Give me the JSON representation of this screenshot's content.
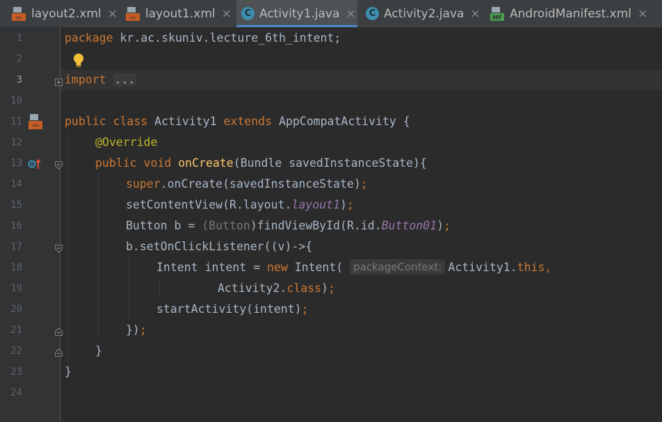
{
  "tabs": [
    {
      "label": "layout2.xml",
      "icon": "xml-layout-icon",
      "active": false
    },
    {
      "label": "layout1.xml",
      "icon": "xml-layout-icon",
      "active": false
    },
    {
      "label": "Activity1.java",
      "icon": "java-class-icon",
      "active": true
    },
    {
      "label": "Activity2.java",
      "icon": "java-class-icon",
      "active": false
    },
    {
      "label": "AndroidManifest.xml",
      "icon": "manifest-icon",
      "active": false
    }
  ],
  "tab_close_glyph": "×",
  "icon_letters": {
    "java": "C",
    "manifest": "MF"
  },
  "line_numbers": [
    "1",
    "2",
    "3",
    "10",
    "11",
    "12",
    "13",
    "14",
    "15",
    "16",
    "17",
    "18",
    "19",
    "20",
    "21",
    "22",
    "23",
    "24"
  ],
  "current_line": "3",
  "code": {
    "l1_kw": "package",
    "l1_rest": " kr.ac.skuniv.lecture_6th_intent;",
    "l3_kw": "import",
    "l3_fold": "...",
    "l11_kw1": "public",
    "l11_kw2": "class",
    "l11_name": " Activity1 ",
    "l11_kw3": "extends",
    "l11_rest": " AppCompatActivity {",
    "l12_ann": "@Override",
    "l13_kw1": "public",
    "l13_kw2": "void",
    "l13_fn": "onCreate",
    "l13_rest": "(Bundle savedInstanceState){",
    "l14_kw": "super",
    "l14_rest": ".onCreate(savedInstanceState)",
    "l14_semi": ";",
    "l15_a": "setContentView(R.layout.",
    "l15_it": "layout1",
    "l15_b": ")",
    "l15_semi": ";",
    "l16_a": "Button b = ",
    "l16_cast_open": "(",
    "l16_cast": "Button",
    "l16_cast_close": ")",
    "l16_b": "findViewById(R.id.",
    "l16_it": "Button01",
    "l16_c": ")",
    "l16_semi": ";",
    "l17": "b.setOnClickListener((v)->{",
    "l18_a": "Intent intent = ",
    "l18_kw": "new",
    "l18_b": " Intent( ",
    "l18_hint": "packageContext:",
    "l18_c": "Activity1.",
    "l18_this": "this",
    "l18_comma": ",",
    "l19_a": "Activity2.",
    "l19_kw": "class",
    "l19_b": ")",
    "l19_semi": ";",
    "l20_a": "startActivity(intent)",
    "l20_semi": ";",
    "l21_a": "})",
    "l21_semi": ";",
    "l22": "}",
    "l23": "}"
  },
  "colors": {
    "background": "#2b2b2b",
    "gutter": "#313335",
    "keyword": "#cc7832",
    "annotation": "#bbb529",
    "method": "#ffc66d",
    "field": "#9876aa",
    "text": "#a9b7c6",
    "active_tab_underline": "#4a88c7"
  }
}
